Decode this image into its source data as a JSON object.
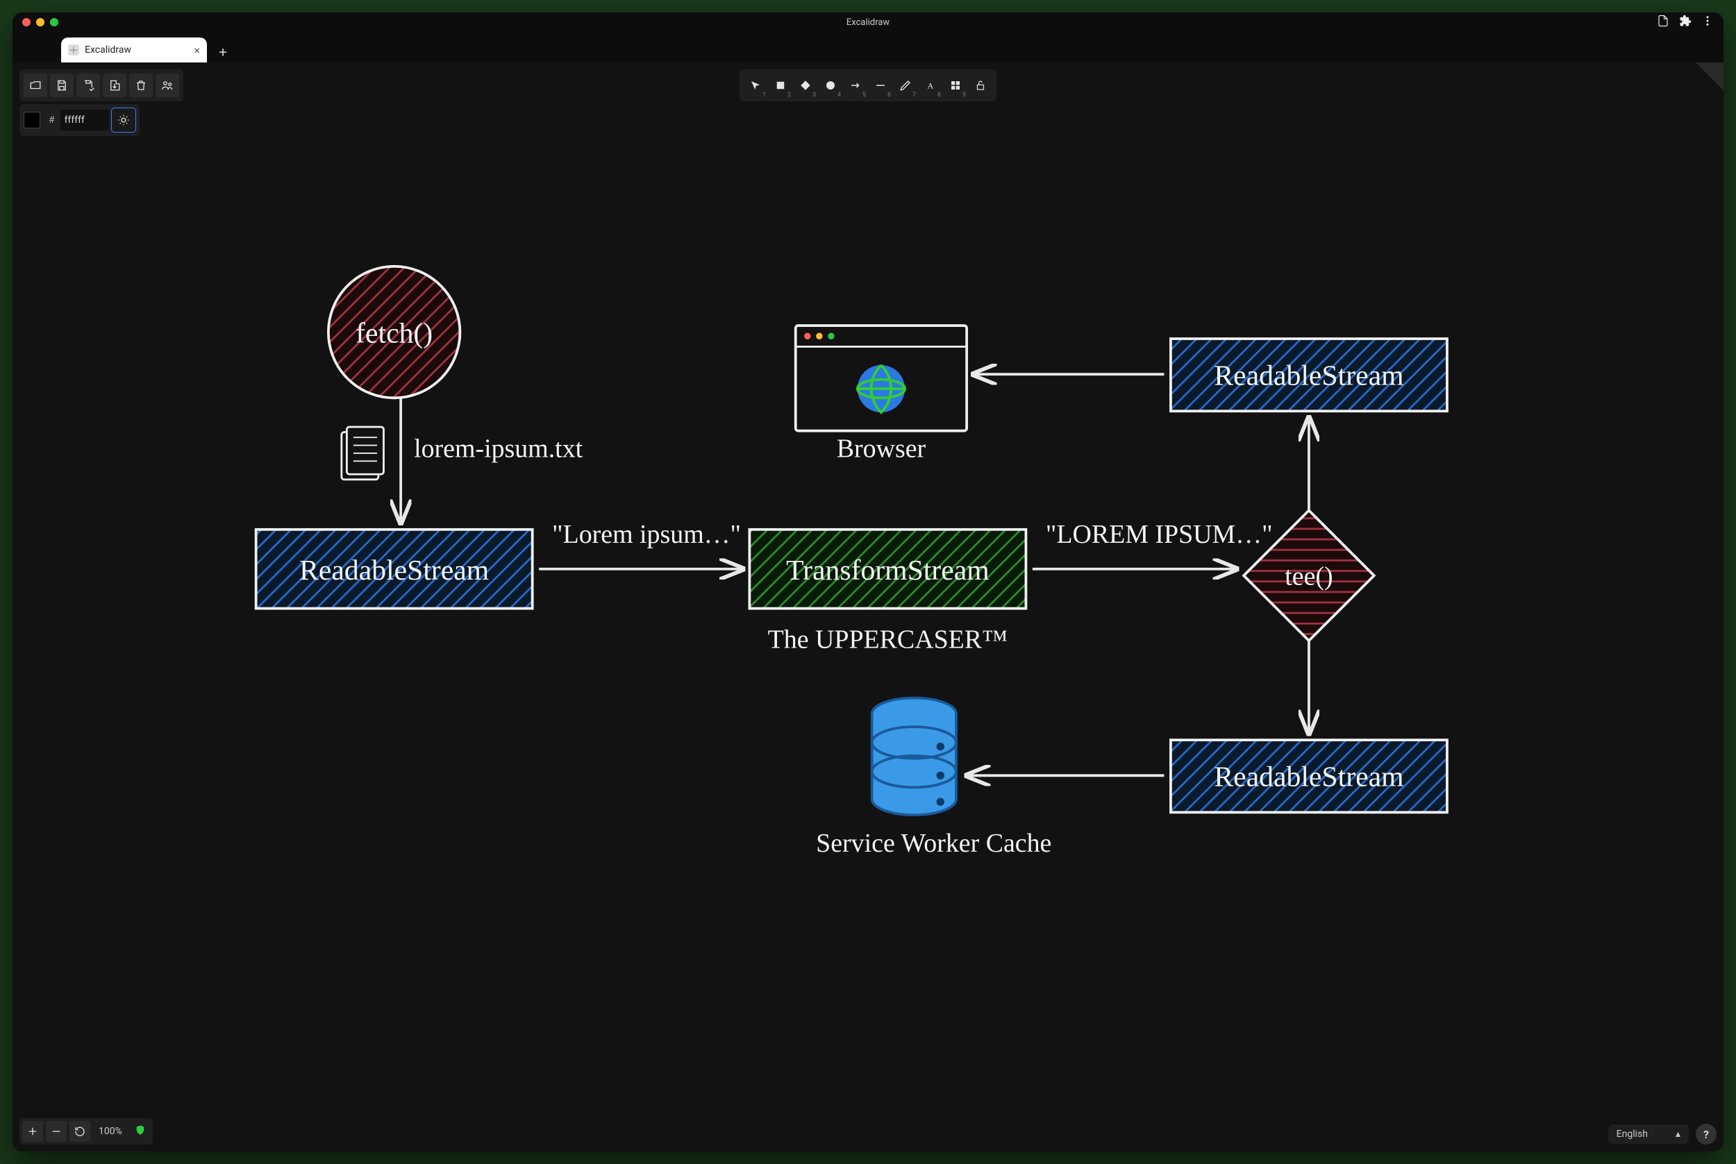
{
  "window": {
    "title": "Excalidraw",
    "tab_title": "Excalidraw"
  },
  "toolbar": {
    "open": "Open",
    "save": "Save",
    "saveas": "Save as",
    "export": "Export",
    "delete": "Delete",
    "collab": "Collaborate"
  },
  "color": {
    "value": "ffffff"
  },
  "tools": {
    "select": "1",
    "rect": "2",
    "diamond": "3",
    "ellipse": "4",
    "arrow": "5",
    "line": "6",
    "draw": "7",
    "text": "8",
    "image": "9"
  },
  "zoom": {
    "level": "100%"
  },
  "language": "English",
  "diagram": {
    "fetch": "fetch()",
    "file_label": "lorem-ipsum.txt",
    "readable1": "ReadableStream",
    "lorem_lower": "\"Lorem ipsum…\"",
    "transform": "TransformStream",
    "uppercaser": "The UPPERCASER™",
    "lorem_upper": "\"LOREM IPSUM…\"",
    "tee": "tee()",
    "readable2": "ReadableStream",
    "readable3": "ReadableStream",
    "browser": "Browser",
    "swcache": "Service Worker Cache"
  }
}
